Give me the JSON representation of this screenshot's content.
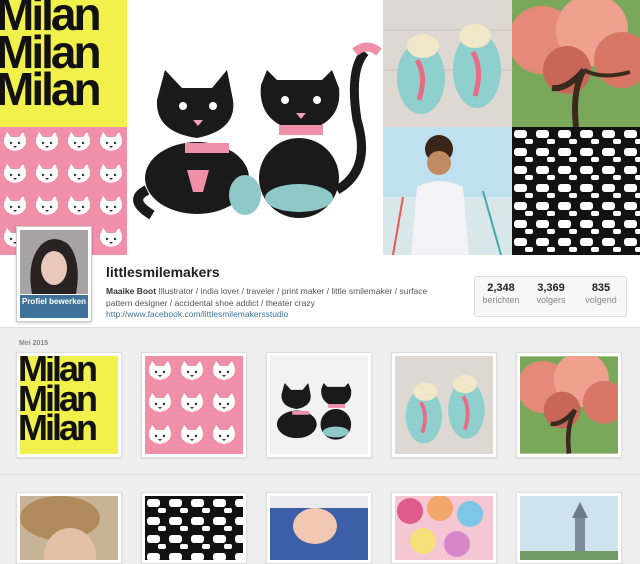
{
  "profile": {
    "username": "littlesmilemakers",
    "full_name": "Maaike Boot",
    "bio": "Illustrator / india lover / traveler / print maker / little smilemaker / surface pattern designer / accidental shoe addict / theater crazy",
    "url": "http://www.facebook.com/littlesmilemakersstudio",
    "edit_button": "Profiel bewerken"
  },
  "stats": [
    {
      "value": "2,348",
      "label": "berichten"
    },
    {
      "value": "3,369",
      "label": "volgers"
    },
    {
      "value": "835",
      "label": "volgend"
    }
  ],
  "section_label": "Mei 2015",
  "milan_words": [
    "Milan",
    "Milan",
    "Milan"
  ],
  "icons": [
    "cat-icon",
    "flamingo-shoe-image",
    "tree-image"
  ],
  "colors": {
    "link": "#3f729b",
    "pink": "#ef8fa8",
    "yellow": "#f2f04a",
    "black": "#111111"
  }
}
